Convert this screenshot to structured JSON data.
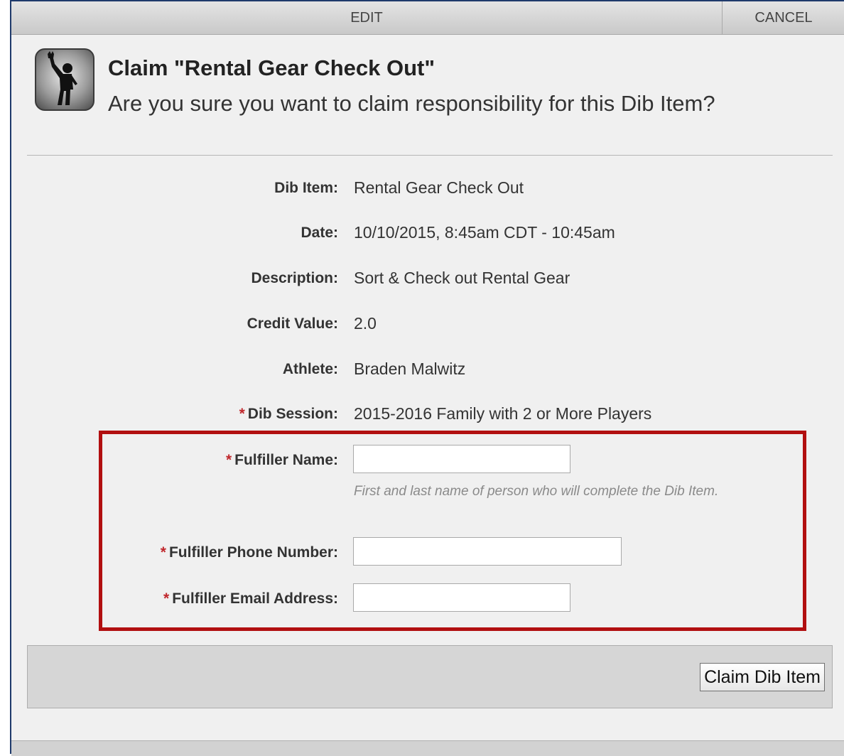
{
  "toolbar": {
    "edit_label": "EDIT",
    "cancel_label": "CANCEL"
  },
  "header": {
    "icon": "person-waving-icon",
    "title": "Claim \"Rental Gear Check Out\"",
    "subtitle": "Are you sure you want to claim responsibility for this Dib Item?"
  },
  "details": {
    "dib_item": {
      "label": "Dib Item:",
      "value": "Rental Gear Check Out"
    },
    "date": {
      "label": "Date:",
      "value": "10/10/2015, 8:45am CDT - 10:45am"
    },
    "description": {
      "label": "Description:",
      "value": "Sort & Check out Rental Gear"
    },
    "credit_value": {
      "label": "Credit Value:",
      "value": "2.0"
    },
    "athlete": {
      "label": "Athlete:",
      "value": "Braden Malwitz"
    },
    "dib_session": {
      "required_mark": "*",
      "label": "Dib Session:",
      "value": "2015-2016 Family with 2 or More Players"
    }
  },
  "form": {
    "fulfiller_name": {
      "required_mark": "*",
      "label": "Fulfiller Name:",
      "value": "",
      "hint": "First and last name of person who will complete the Dib Item."
    },
    "fulfiller_phone": {
      "required_mark": "*",
      "label": "Fulfiller Phone Number:",
      "value": ""
    },
    "fulfiller_email": {
      "required_mark": "*",
      "label": "Fulfiller Email Address:",
      "value": ""
    }
  },
  "footer": {
    "claim_button_label": "Claim Dib Item"
  },
  "colors": {
    "required": "#c0282d",
    "highlight_border": "#b10f10",
    "window_border": "#1f3a6b"
  }
}
